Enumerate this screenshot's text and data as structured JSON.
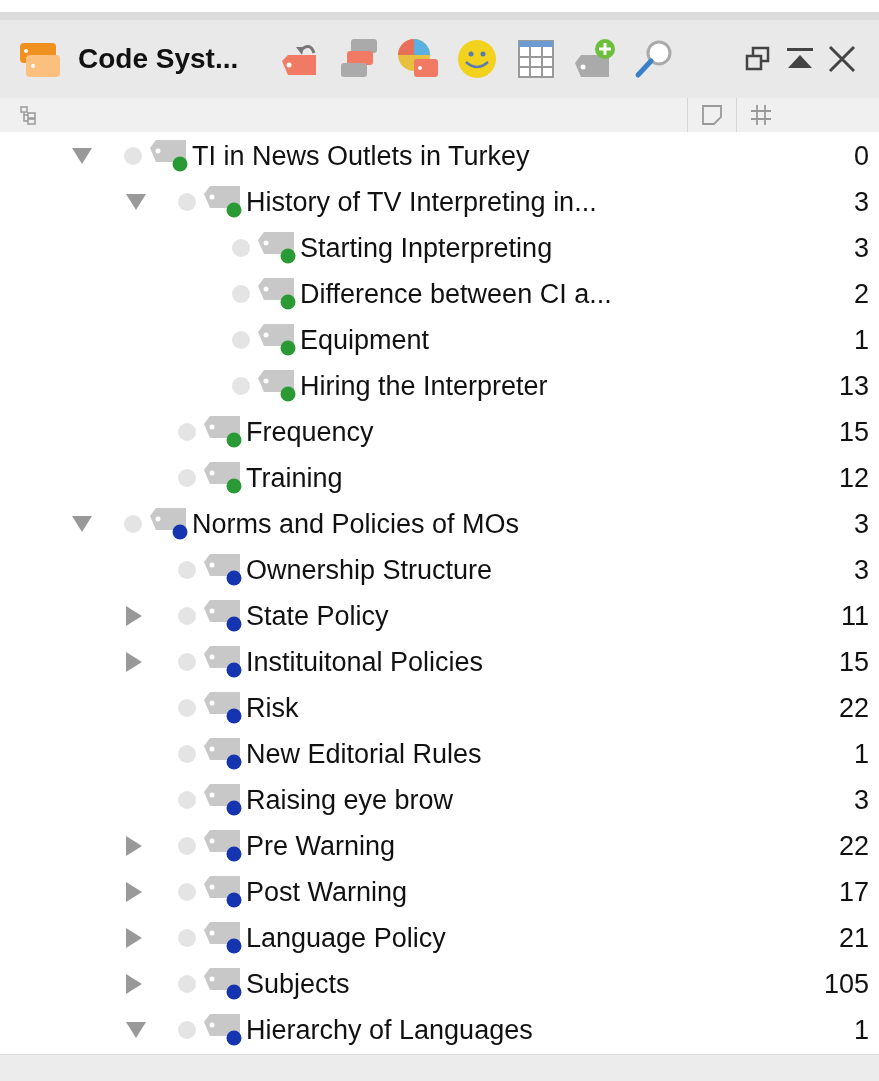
{
  "panel": {
    "title": "Code Syst..."
  },
  "tree": [
    {
      "label": "TI in News Outlets in Turkey",
      "count": "0",
      "color": "#2a9a35",
      "expanded": true,
      "children": [
        {
          "label": "History of TV Interpreting in...",
          "count": "3",
          "color": "#2a9a35",
          "expanded": true,
          "children": [
            {
              "label": "Starting Inpterpreting",
              "count": "3",
              "color": "#2a9a35"
            },
            {
              "label": "Difference between CI a...",
              "count": "2",
              "color": "#2a9a35"
            },
            {
              "label": "Equipment",
              "count": "1",
              "color": "#2a9a35"
            },
            {
              "label": "Hiring the Interpreter",
              "count": "13",
              "color": "#2a9a35"
            }
          ]
        },
        {
          "label": "Frequency",
          "count": "15",
          "color": "#2a9a35"
        },
        {
          "label": "Training",
          "count": "12",
          "color": "#2a9a35"
        }
      ]
    },
    {
      "label": "Norms and Policies of MOs",
      "count": "3",
      "color": "#1535b0",
      "expanded": true,
      "children": [
        {
          "label": "Ownership Structure",
          "count": "3",
          "color": "#1535b0"
        },
        {
          "label": "State Policy",
          "count": "11",
          "color": "#1535b0",
          "expanded": false
        },
        {
          "label": "Instituitonal Policies",
          "count": "15",
          "color": "#1535b0",
          "expanded": false
        },
        {
          "label": "Risk",
          "count": "22",
          "color": "#1535b0"
        },
        {
          "label": "New Editorial Rules",
          "count": "1",
          "color": "#1535b0"
        },
        {
          "label": "Raising eye brow",
          "count": "3",
          "color": "#1535b0"
        },
        {
          "label": "Pre Warning",
          "count": "22",
          "color": "#1535b0",
          "expanded": false
        },
        {
          "label": "Post Warning",
          "count": "17",
          "color": "#1535b0",
          "expanded": false
        },
        {
          "label": "Language Policy",
          "count": "21",
          "color": "#1535b0",
          "expanded": false
        },
        {
          "label": "Subjects",
          "count": "105",
          "color": "#1535b0",
          "expanded": false
        },
        {
          "label": "Hierarchy of Languages",
          "count": "1",
          "color": "#1535b0",
          "expanded": true
        }
      ]
    }
  ]
}
